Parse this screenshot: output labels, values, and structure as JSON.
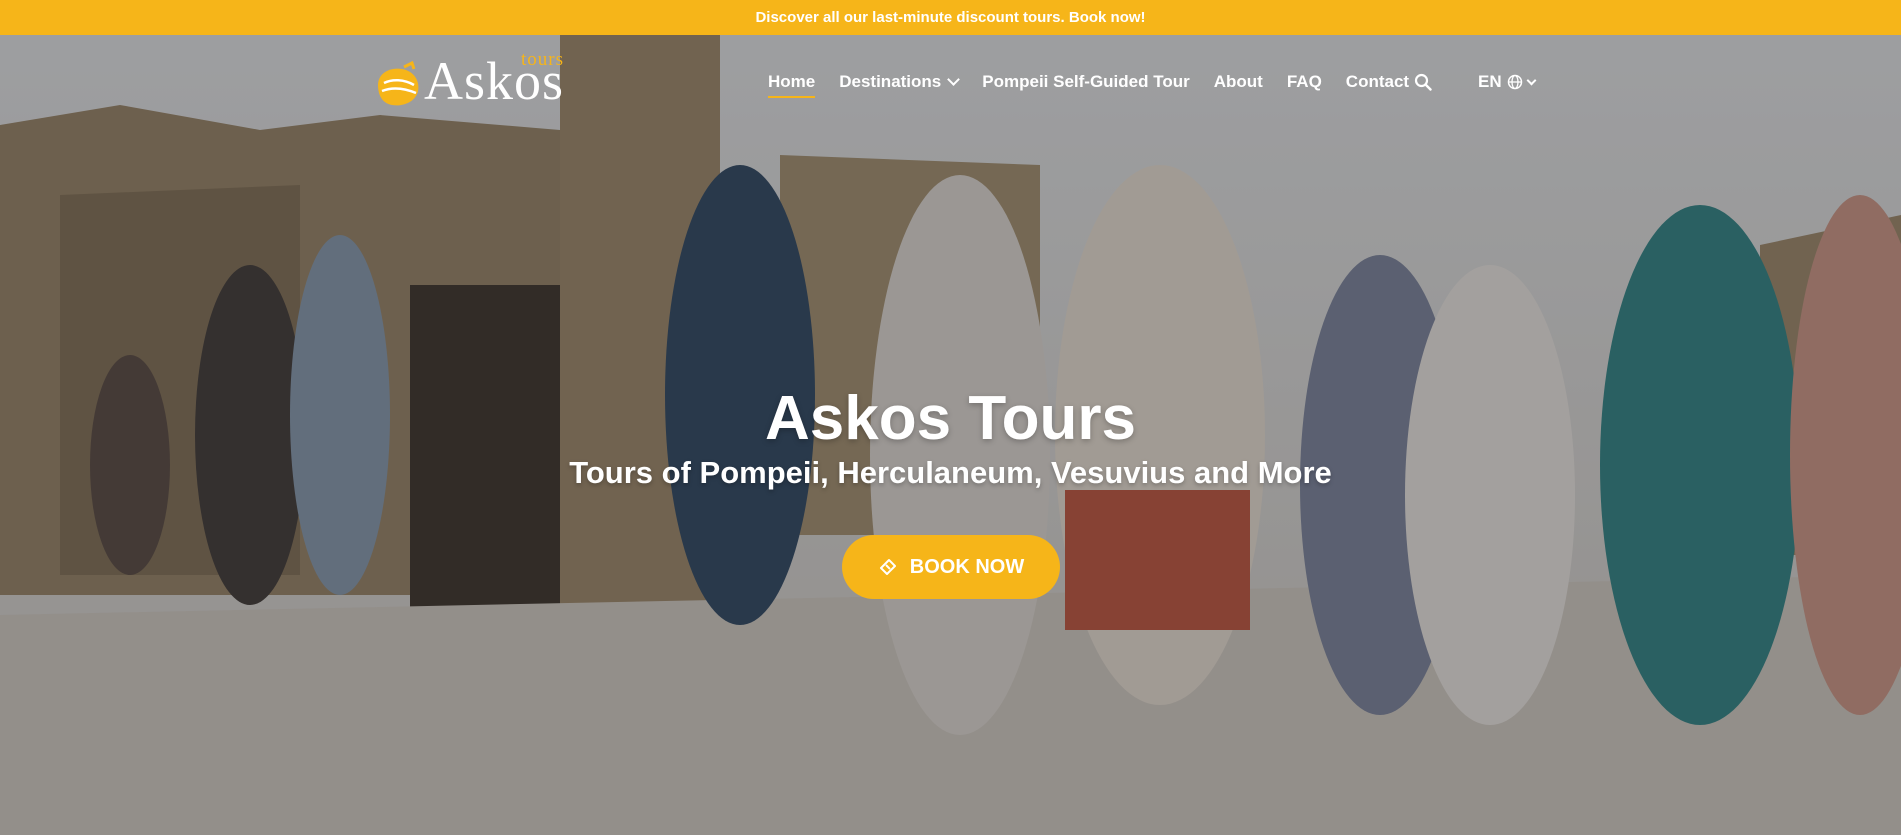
{
  "banner": {
    "text": "Discover all our last-minute discount tours. Book now!"
  },
  "logo": {
    "main": "Askos",
    "sub": "tours"
  },
  "nav": {
    "items": [
      {
        "label": "Home",
        "active": true,
        "has_dropdown": false
      },
      {
        "label": "Destinations",
        "active": false,
        "has_dropdown": true
      },
      {
        "label": "Pompeii Self-Guided Tour",
        "active": false,
        "has_dropdown": false
      },
      {
        "label": "About",
        "active": false,
        "has_dropdown": false
      },
      {
        "label": "FAQ",
        "active": false,
        "has_dropdown": false
      },
      {
        "label": "Contact",
        "active": false,
        "has_dropdown": false
      }
    ],
    "search_icon": "search-icon",
    "language": "EN",
    "language_icon": "globe-icon"
  },
  "hero": {
    "title": "Askos Tours",
    "subtitle": "Tours of Pompeii, Herculaneum, Vesuvius and More",
    "cta_label": "BOOK NOW",
    "cta_icon": "ticket-icon"
  },
  "colors": {
    "accent": "#f6b519",
    "text": "#ffffff"
  }
}
